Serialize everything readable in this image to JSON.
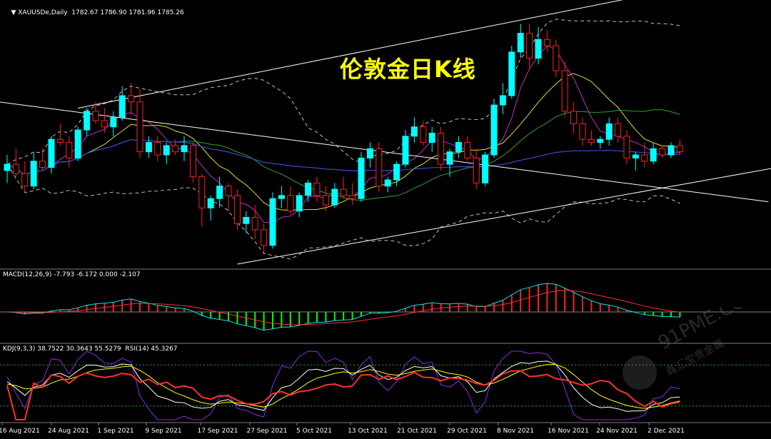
{
  "header": {
    "symbol_line": "XAUUSDe,Daily  1782.67 1786.90 1781.96 1785.26"
  },
  "overlay_title": "伦敦金日K线",
  "watermark": {
    "text": "91PME.COM",
    "sub": "鑫汇宝贵金属"
  },
  "colors": {
    "bull": "#00ffff",
    "bear": "#ff2020",
    "macd_hist_pos": "#ff2020",
    "macd_hist_neg": "#00ff00",
    "signal": "#ff3030",
    "macd_line": "#00e5ee",
    "kdj_k": "#ffffff",
    "kdj_d": "#ffff00",
    "kdj_j": "#8a2be2",
    "rsi": "#ff3030",
    "ma_yellow": "#dcdc32",
    "ma_green": "#32a032",
    "ma_magenta": "#c030c0",
    "ma_blue": "#3a4ad0"
  },
  "chart_data": {
    "type": "candlestick",
    "symbol": "XAUUSDe",
    "timeframe": "Daily",
    "last_ohlc": [
      1782.67,
      1786.9,
      1781.96,
      1785.26
    ],
    "x_labels": [
      "16 Aug 2021",
      "24 Aug 2021",
      "1 Sep 2021",
      "9 Sep 2021",
      "17 Sep 2021",
      "27 Sep 2021",
      "5 Oct 2021",
      "13 Oct 2021",
      "21 Oct 2021",
      "29 Oct 2021",
      "8 Nov 2021",
      "16 Nov 2021",
      "24 Nov 2021",
      "2 Dec 2021"
    ],
    "price_range": [
      1718,
      1880
    ],
    "candles": [
      [
        1778,
        1788,
        1770,
        1782
      ],
      [
        1782,
        1792,
        1774,
        1776
      ],
      [
        1776,
        1784,
        1764,
        1768
      ],
      [
        1768,
        1790,
        1766,
        1784
      ],
      [
        1784,
        1792,
        1778,
        1780
      ],
      [
        1780,
        1800,
        1776,
        1798
      ],
      [
        1798,
        1808,
        1794,
        1796
      ],
      [
        1796,
        1800,
        1780,
        1786
      ],
      [
        1786,
        1806,
        1784,
        1804
      ],
      [
        1804,
        1818,
        1800,
        1816
      ],
      [
        1816,
        1822,
        1808,
        1810
      ],
      [
        1810,
        1818,
        1802,
        1806
      ],
      [
        1806,
        1816,
        1800,
        1812
      ],
      [
        1812,
        1832,
        1810,
        1826
      ],
      [
        1826,
        1834,
        1814,
        1822
      ],
      [
        1822,
        1830,
        1786,
        1790
      ],
      [
        1790,
        1800,
        1786,
        1796
      ],
      [
        1796,
        1800,
        1784,
        1788
      ],
      [
        1788,
        1796,
        1782,
        1794
      ],
      [
        1794,
        1798,
        1788,
        1790
      ],
      [
        1790,
        1800,
        1784,
        1794
      ],
      [
        1794,
        1796,
        1770,
        1774
      ],
      [
        1774,
        1776,
        1742,
        1754
      ],
      [
        1754,
        1762,
        1746,
        1760
      ],
      [
        1760,
        1774,
        1754,
        1768
      ],
      [
        1768,
        1770,
        1752,
        1762
      ],
      [
        1762,
        1766,
        1740,
        1744
      ],
      [
        1744,
        1752,
        1738,
        1748
      ],
      [
        1748,
        1756,
        1734,
        1740
      ],
      [
        1740,
        1744,
        1724,
        1730
      ],
      [
        1730,
        1764,
        1728,
        1760
      ],
      [
        1760,
        1768,
        1754,
        1762
      ],
      [
        1762,
        1768,
        1750,
        1752
      ],
      [
        1752,
        1764,
        1748,
        1762
      ],
      [
        1762,
        1772,
        1758,
        1770
      ],
      [
        1770,
        1774,
        1758,
        1762
      ],
      [
        1762,
        1768,
        1752,
        1756
      ],
      [
        1756,
        1770,
        1754,
        1766
      ],
      [
        1766,
        1774,
        1760,
        1762
      ],
      [
        1762,
        1770,
        1756,
        1760
      ],
      [
        1760,
        1790,
        1758,
        1786
      ],
      [
        1786,
        1796,
        1780,
        1792
      ],
      [
        1792,
        1796,
        1764,
        1768
      ],
      [
        1768,
        1774,
        1764,
        1772
      ],
      [
        1772,
        1784,
        1768,
        1782
      ],
      [
        1782,
        1804,
        1780,
        1800
      ],
      [
        1800,
        1812,
        1796,
        1806
      ],
      [
        1806,
        1810,
        1794,
        1796
      ],
      [
        1796,
        1806,
        1790,
        1802
      ],
      [
        1802,
        1806,
        1778,
        1782
      ],
      [
        1782,
        1792,
        1774,
        1790
      ],
      [
        1790,
        1800,
        1786,
        1796
      ],
      [
        1796,
        1800,
        1784,
        1786
      ],
      [
        1786,
        1792,
        1766,
        1770
      ],
      [
        1770,
        1790,
        1768,
        1788
      ],
      [
        1788,
        1824,
        1786,
        1820
      ],
      [
        1820,
        1834,
        1814,
        1826
      ],
      [
        1826,
        1858,
        1824,
        1854
      ],
      [
        1854,
        1872,
        1850,
        1866
      ],
      [
        1866,
        1872,
        1844,
        1850
      ],
      [
        1850,
        1870,
        1846,
        1862
      ],
      [
        1862,
        1868,
        1854,
        1858
      ],
      [
        1858,
        1862,
        1838,
        1842
      ],
      [
        1842,
        1848,
        1812,
        1816
      ],
      [
        1816,
        1822,
        1802,
        1808
      ],
      [
        1808,
        1812,
        1794,
        1798
      ],
      [
        1798,
        1804,
        1794,
        1796
      ],
      [
        1796,
        1800,
        1792,
        1798
      ],
      [
        1798,
        1812,
        1794,
        1808
      ],
      [
        1808,
        1812,
        1796,
        1800
      ],
      [
        1800,
        1804,
        1782,
        1786
      ],
      [
        1786,
        1790,
        1778,
        1788
      ],
      [
        1788,
        1796,
        1780,
        1784
      ],
      [
        1784,
        1796,
        1782,
        1792
      ],
      [
        1792,
        1794,
        1786,
        1788
      ],
      [
        1788,
        1796,
        1786,
        1794
      ],
      [
        1794,
        1798,
        1788,
        1790
      ]
    ],
    "macd_label": "MACD(12,26,9) -7.793 -6.172 0.000 -2.107",
    "macd": {
      "values": [
        -7.793,
        -6.172,
        0.0,
        -2.107
      ]
    },
    "kdj_label": "KDJ(9,3,3) 38.7522 30.3643 55.5279  RSI(14) 45.3267",
    "kdj": {
      "K": 38.7522,
      "D": 30.3643,
      "J": 55.5279
    },
    "rsi": 45.3267
  }
}
